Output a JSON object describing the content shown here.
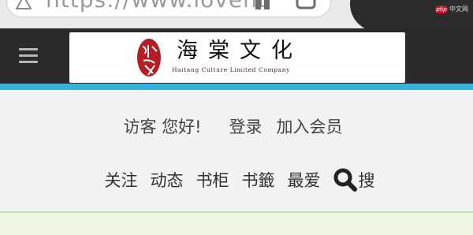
{
  "browser": {
    "url_text": "https://www.lovehtbe",
    "watermark_text": "中文网",
    "watermark_logo": "php"
  },
  "header": {
    "logo_title": "海棠文化",
    "logo_subtitle": "Haitang Culture Limited Company",
    "seal_text": "海棠",
    "header_bg": "#2a2a2c",
    "accent_color": "#3aaee0"
  },
  "welcome": {
    "greeting": "访客 您好!",
    "login_label": "登录",
    "register_label": "加入会员"
  },
  "nav": {
    "items": [
      {
        "label": "关注"
      },
      {
        "label": "动态"
      },
      {
        "label": "书柜"
      },
      {
        "label": "书籤"
      },
      {
        "label": "最爱"
      }
    ],
    "search_label": "搜",
    "search_icon": "search-icon"
  }
}
